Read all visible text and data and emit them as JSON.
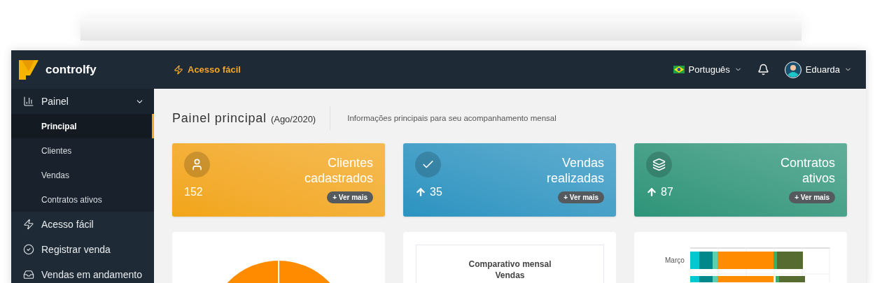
{
  "brand": {
    "name": "controlfy"
  },
  "header": {
    "quick_access": "Acesso fácil",
    "language": "Português",
    "user": "Eduarda"
  },
  "sidebar": {
    "items": [
      {
        "label": "Painel",
        "kind": "group",
        "expanded": true,
        "children": [
          {
            "label": "Principal",
            "selected": true
          },
          {
            "label": "Clientes",
            "selected": false
          },
          {
            "label": "Vendas",
            "selected": false
          },
          {
            "label": "Contratos ativos",
            "selected": false
          }
        ]
      },
      {
        "label": "Acesso fácil",
        "kind": "link"
      },
      {
        "label": "Registrar venda",
        "kind": "link"
      },
      {
        "label": "Vendas em andamento",
        "kind": "link"
      }
    ]
  },
  "page": {
    "title": "Painel principal",
    "period": "(Ago/2020)",
    "subtitle": "Informações principais para seu acompanhamento mensal"
  },
  "cards": [
    {
      "title": "Clientes cadastrados",
      "value": "152",
      "trend_up": false,
      "link": "+ Ver mais",
      "color": "#f2a516"
    },
    {
      "title": "Vendas realizadas",
      "value": "35",
      "trend_up": true,
      "link": "+ Ver mais",
      "color": "#2a93c0"
    },
    {
      "title": "Contratos ativos",
      "value": "87",
      "trend_up": true,
      "link": "+ Ver mais",
      "color": "#2c9478"
    }
  ],
  "panels": [
    {
      "kind": "pie"
    },
    {
      "kind": "titled",
      "title": "Comparativo mensal",
      "subtitle": "Vendas"
    },
    {
      "kind": "bars",
      "label": "Março"
    }
  ]
}
